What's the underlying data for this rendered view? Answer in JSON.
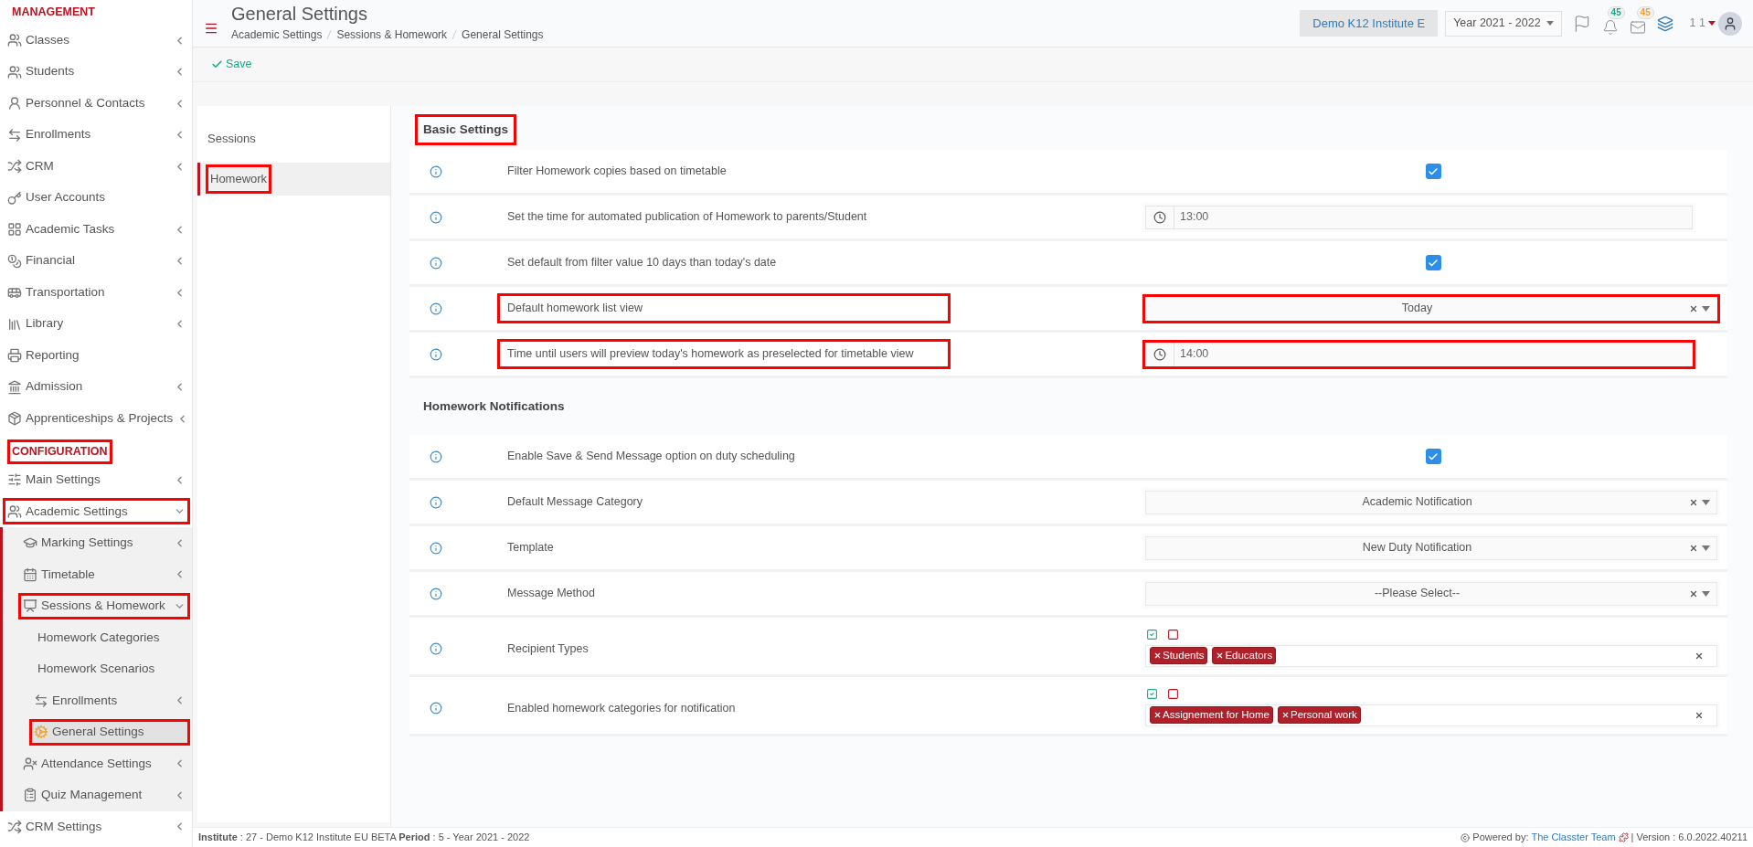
{
  "sidebar": {
    "sections": [
      {
        "title": "MANAGEMENT",
        "highlighted": false,
        "items": [
          {
            "label": "Classes",
            "has_submenu": true,
            "expanded": false,
            "selected": false,
            "highlighted": false
          },
          {
            "label": "Students",
            "has_submenu": true,
            "expanded": false,
            "selected": false,
            "highlighted": false
          },
          {
            "label": "Personnel & Contacts",
            "has_submenu": true,
            "expanded": false,
            "selected": false,
            "highlighted": false
          },
          {
            "label": "Enrollments",
            "has_submenu": true,
            "expanded": false,
            "selected": false,
            "highlighted": false
          },
          {
            "label": "CRM",
            "has_submenu": true,
            "expanded": false,
            "selected": false,
            "highlighted": false
          },
          {
            "label": "User Accounts",
            "has_submenu": false,
            "selected": false,
            "highlighted": false
          },
          {
            "label": "Academic Tasks",
            "has_submenu": true,
            "expanded": false,
            "selected": false,
            "highlighted": false
          },
          {
            "label": "Financial",
            "has_submenu": true,
            "expanded": false,
            "selected": false,
            "highlighted": false
          },
          {
            "label": "Transportation",
            "has_submenu": true,
            "expanded": false,
            "selected": false,
            "highlighted": false
          },
          {
            "label": "Library",
            "has_submenu": true,
            "expanded": false,
            "selected": false,
            "highlighted": false
          },
          {
            "label": "Reporting",
            "has_submenu": false,
            "selected": false,
            "highlighted": false
          },
          {
            "label": "Admission",
            "has_submenu": true,
            "expanded": false,
            "selected": false,
            "highlighted": false
          },
          {
            "label": "Apprenticeships & Projects",
            "has_submenu": true,
            "expanded": false,
            "selected": false,
            "highlighted": false
          }
        ]
      },
      {
        "title": "CONFIGURATION",
        "highlighted": true,
        "items": [
          {
            "label": "Main Settings",
            "has_submenu": true,
            "expanded": false,
            "selected": false,
            "highlighted": false
          },
          {
            "label": "Academic Settings",
            "has_submenu": true,
            "expanded": true,
            "selected": false,
            "highlighted": true,
            "children": [
              {
                "label": "Marking Settings",
                "has_submenu": true,
                "expanded": false,
                "selected": false,
                "highlighted": false
              },
              {
                "label": "Timetable",
                "has_submenu": true,
                "expanded": false,
                "selected": false,
                "highlighted": false
              },
              {
                "label": "Sessions & Homework",
                "has_submenu": true,
                "expanded": true,
                "selected": false,
                "highlighted": true,
                "children": [
                  {
                    "label": "Homework Categories",
                    "has_submenu": false,
                    "selected": false,
                    "highlighted": false
                  },
                  {
                    "label": "Homework Scenarios",
                    "has_submenu": false,
                    "selected": false,
                    "highlighted": false
                  },
                  {
                    "label": "Enrollments",
                    "has_submenu": true,
                    "expanded": false,
                    "selected": false,
                    "highlighted": false
                  },
                  {
                    "label": "General Settings",
                    "has_submenu": false,
                    "selected": true,
                    "highlighted": true
                  }
                ]
              },
              {
                "label": "Attendance Settings",
                "has_submenu": true,
                "expanded": false,
                "selected": false,
                "highlighted": false
              },
              {
                "label": "Quiz Management",
                "has_submenu": true,
                "expanded": false,
                "selected": false,
                "highlighted": false
              }
            ]
          },
          {
            "label": "CRM Settings",
            "has_submenu": true,
            "expanded": false,
            "selected": false,
            "highlighted": false
          }
        ]
      }
    ]
  },
  "header": {
    "title": "General Settings",
    "breadcrumb": [
      "Academic Settings",
      "Sessions & Homework",
      "General Settings"
    ],
    "institute": "Demo K12 Institute E",
    "year": "Year 2021 - 2022",
    "notifications_badge": "45",
    "messages_badge": "45",
    "user": "1 1"
  },
  "toolbar": {
    "save": "Save"
  },
  "tabs": [
    {
      "label": "Sessions",
      "selected": false,
      "highlighted": false
    },
    {
      "label": "Homework",
      "selected": true,
      "highlighted": true
    }
  ],
  "sections": [
    {
      "title": "Basic Settings",
      "highlighted": true,
      "rows": [
        {
          "label": "Filter Homework copies based on timetable",
          "highlighted": false,
          "control": {
            "kind": "checkbox",
            "checked": true
          }
        },
        {
          "label": "Set the time for automated publication of Homework to parents/Student",
          "highlighted": false,
          "control": {
            "kind": "time",
            "value": "13:00",
            "highlighted": false
          }
        },
        {
          "label": "Set default from filter value 10 days than today's date",
          "highlighted": false,
          "control": {
            "kind": "checkbox",
            "checked": true
          }
        },
        {
          "label": "Default homework list view",
          "highlighted": true,
          "control": {
            "kind": "select",
            "value": "Today",
            "highlighted": true
          }
        },
        {
          "label": "Time until users will preview today's homework as preselected for timetable view",
          "highlighted": true,
          "control": {
            "kind": "time",
            "value": "14:00",
            "highlighted": true
          }
        }
      ]
    },
    {
      "title": "Homework Notifications",
      "highlighted": false,
      "rows": [
        {
          "label": "Enable Save & Send Message option on duty scheduling",
          "highlighted": false,
          "control": {
            "kind": "checkbox",
            "checked": true
          }
        },
        {
          "label": "Default Message Category",
          "highlighted": false,
          "control": {
            "kind": "select",
            "value": "Academic Notification",
            "highlighted": false
          }
        },
        {
          "label": "Template",
          "highlighted": false,
          "control": {
            "kind": "select",
            "value": "New Duty Notification",
            "highlighted": false
          }
        },
        {
          "label": "Message Method",
          "highlighted": false,
          "control": {
            "kind": "select",
            "value": "--Please Select--",
            "highlighted": false
          }
        },
        {
          "label": "Recipient Types",
          "highlighted": false,
          "control": {
            "kind": "tags",
            "tags": [
              "Students",
              "Educators"
            ],
            "highlighted": false
          }
        },
        {
          "label": "Enabled homework categories for notification",
          "highlighted": false,
          "control": {
            "kind": "tags",
            "tags": [
              "Assignement for Home",
              "Personal work"
            ],
            "highlighted": false
          }
        }
      ]
    }
  ],
  "footer": {
    "info": "**Institute** : 27 - Demo K12 Institute EU BETA **Period** : 5 - Year 2021 - 2022",
    "powered": "Powered by:",
    "team": "The Classter Team",
    "version": "| Version : 6.0.2022.40211"
  }
}
